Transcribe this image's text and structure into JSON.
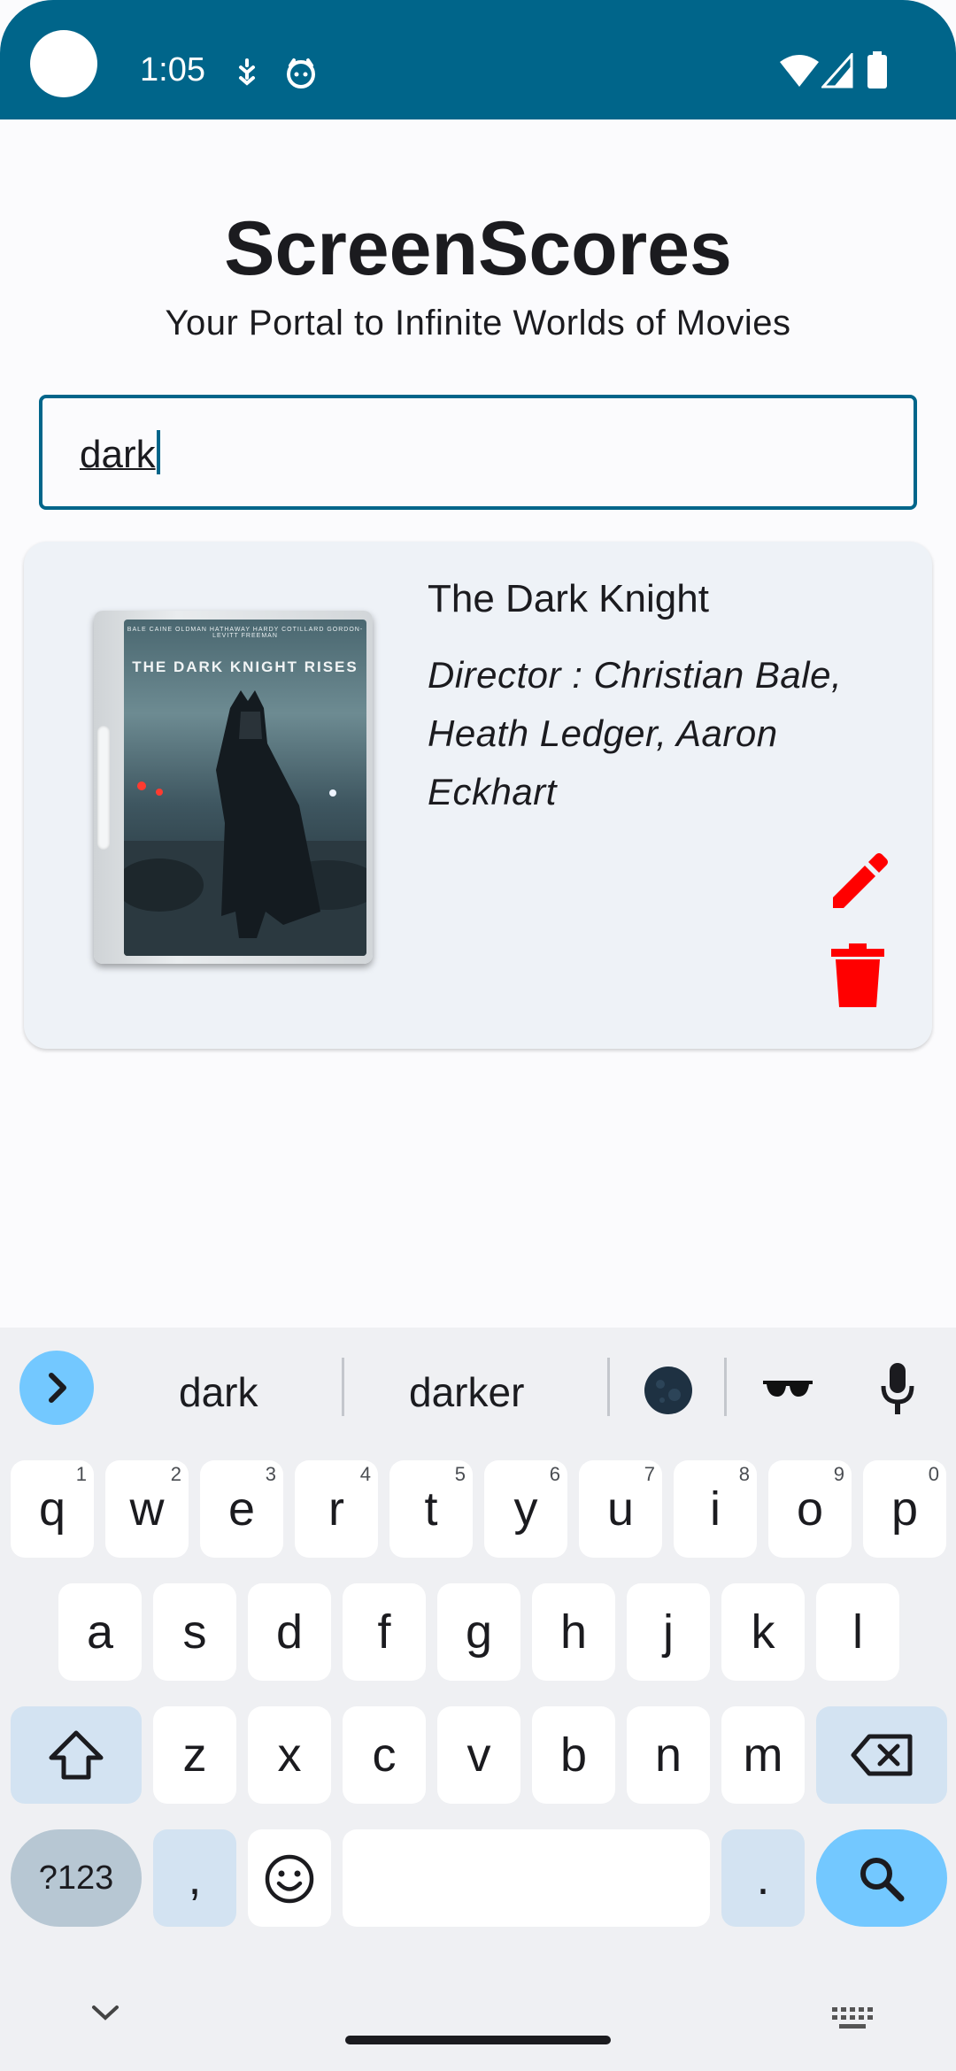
{
  "status_bar": {
    "time": "1:05"
  },
  "header": {
    "title": "ScreenScores",
    "subtitle": "Your Portal to Infinite Worlds of Movies"
  },
  "search": {
    "value": "dark"
  },
  "results": [
    {
      "title": "The Dark Knight",
      "director": "Director : Christian Bale, Heath Ledger, Aaron Eckhart",
      "poster_title": "THE DARK KNIGHT RISES",
      "poster_credits": "BALE  CAINE  OLDMAN  HATHAWAY  HARDY  COTILLARD  GORDON-LEVITT  FREEMAN"
    }
  ],
  "keyboard": {
    "suggestions": [
      "dark",
      "darker"
    ],
    "emoji_suggestions": [
      "moon-emoji",
      "sunglasses-emoji"
    ],
    "row1": [
      {
        "key": "q",
        "hint": "1"
      },
      {
        "key": "w",
        "hint": "2"
      },
      {
        "key": "e",
        "hint": "3"
      },
      {
        "key": "r",
        "hint": "4"
      },
      {
        "key": "t",
        "hint": "5"
      },
      {
        "key": "y",
        "hint": "6"
      },
      {
        "key": "u",
        "hint": "7"
      },
      {
        "key": "i",
        "hint": "8"
      },
      {
        "key": "o",
        "hint": "9"
      },
      {
        "key": "p",
        "hint": "0"
      }
    ],
    "row2": [
      "a",
      "s",
      "d",
      "f",
      "g",
      "h",
      "j",
      "k",
      "l"
    ],
    "row3": [
      "z",
      "x",
      "c",
      "v",
      "b",
      "n",
      "m"
    ],
    "symbols_label": "?123",
    "comma": ",",
    "period": "."
  },
  "colors": {
    "primary": "#00658a",
    "danger": "#ff0000",
    "card": "#eef2f7",
    "accent_key": "#73c8ff"
  }
}
